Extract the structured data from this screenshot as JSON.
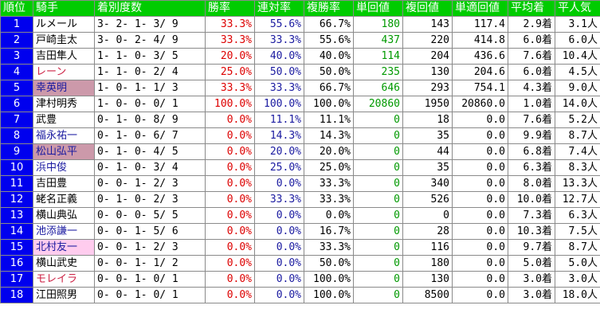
{
  "headers": [
    "順位",
    "騎手",
    "着別度数",
    "勝率",
    "連対率",
    "複勝率",
    "単回値",
    "複回値",
    "単適回値",
    "平均着",
    "平人気"
  ],
  "rows": [
    {
      "rank": "1",
      "jockey": "ルメール",
      "jockey_color": "black",
      "jockey_bg": "",
      "dist": "3- 2- 1- 3/ 9",
      "win": "33.3%",
      "top2": "55.6%",
      "top3": "66.7%",
      "win_ret": "180",
      "place_ret": "143",
      "adj_ret": "117.4",
      "avg_finish": "2.9着",
      "avg_pop": "3.1人"
    },
    {
      "rank": "2",
      "jockey": "戸崎圭太",
      "jockey_color": "black",
      "jockey_bg": "",
      "dist": "3- 0- 2- 4/ 9",
      "win": "33.3%",
      "top2": "33.3%",
      "top3": "55.6%",
      "win_ret": "437",
      "place_ret": "220",
      "adj_ret": "414.8",
      "avg_finish": "6.0着",
      "avg_pop": "6.0人"
    },
    {
      "rank": "3",
      "jockey": "吉田隼人",
      "jockey_color": "black",
      "jockey_bg": "",
      "dist": "1- 1- 0- 3/ 5",
      "win": "20.0%",
      "top2": "40.0%",
      "top3": "40.0%",
      "win_ret": "114",
      "place_ret": "204",
      "adj_ret": "436.6",
      "avg_finish": "7.6着",
      "avg_pop": "10.4人"
    },
    {
      "rank": "4",
      "jockey": "レーン",
      "jockey_color": "red",
      "jockey_bg": "",
      "dist": "1- 1- 0- 2/ 4",
      "win": "25.0%",
      "top2": "50.0%",
      "top3": "50.0%",
      "win_ret": "235",
      "place_ret": "130",
      "adj_ret": "204.6",
      "avg_finish": "6.0着",
      "avg_pop": "4.5人"
    },
    {
      "rank": "5",
      "jockey": "幸英明",
      "jockey_color": "blue",
      "jockey_bg": "rose",
      "dist": "1- 0- 1- 1/ 3",
      "win": "33.3%",
      "top2": "33.3%",
      "top3": "66.7%",
      "win_ret": "646",
      "place_ret": "293",
      "adj_ret": "754.1",
      "avg_finish": "4.3着",
      "avg_pop": "9.0人"
    },
    {
      "rank": "6",
      "jockey": "津村明秀",
      "jockey_color": "black",
      "jockey_bg": "",
      "dist": "1- 0- 0- 0/ 1",
      "win": "100.0%",
      "top2": "100.0%",
      "top3": "100.0%",
      "win_ret": "20860",
      "place_ret": "1950",
      "adj_ret": "20860.0",
      "avg_finish": "1.0着",
      "avg_pop": "14.0人"
    },
    {
      "rank": "7",
      "jockey": "武豊",
      "jockey_color": "black",
      "jockey_bg": "",
      "dist": "0- 1- 0- 8/ 9",
      "win": "0.0%",
      "top2": "11.1%",
      "top3": "11.1%",
      "win_ret": "0",
      "place_ret": "18",
      "adj_ret": "0.0",
      "avg_finish": "7.6着",
      "avg_pop": "5.2人"
    },
    {
      "rank": "8",
      "jockey": "福永祐一",
      "jockey_color": "blue",
      "jockey_bg": "",
      "dist": "0- 1- 0- 6/ 7",
      "win": "0.0%",
      "top2": "14.3%",
      "top3": "14.3%",
      "win_ret": "0",
      "place_ret": "35",
      "adj_ret": "0.0",
      "avg_finish": "9.9着",
      "avg_pop": "8.7人"
    },
    {
      "rank": "9",
      "jockey": "松山弘平",
      "jockey_color": "blue",
      "jockey_bg": "rose",
      "dist": "0- 1- 0- 4/ 5",
      "win": "0.0%",
      "top2": "20.0%",
      "top3": "20.0%",
      "win_ret": "0",
      "place_ret": "44",
      "adj_ret": "0.0",
      "avg_finish": "6.8着",
      "avg_pop": "7.4人"
    },
    {
      "rank": "10",
      "jockey": "浜中俊",
      "jockey_color": "blue",
      "jockey_bg": "",
      "dist": "0- 1- 0- 3/ 4",
      "win": "0.0%",
      "top2": "25.0%",
      "top3": "25.0%",
      "win_ret": "0",
      "place_ret": "35",
      "adj_ret": "0.0",
      "avg_finish": "6.3着",
      "avg_pop": "8.3人"
    },
    {
      "rank": "11",
      "jockey": "吉田豊",
      "jockey_color": "black",
      "jockey_bg": "",
      "dist": "0- 0- 1- 2/ 3",
      "win": "0.0%",
      "top2": "0.0%",
      "top3": "33.3%",
      "win_ret": "0",
      "place_ret": "340",
      "adj_ret": "0.0",
      "avg_finish": "8.0着",
      "avg_pop": "13.3人"
    },
    {
      "rank": "12",
      "jockey": "蛯名正義",
      "jockey_color": "black",
      "jockey_bg": "",
      "dist": "0- 1- 0- 2/ 3",
      "win": "0.0%",
      "top2": "33.3%",
      "top3": "33.3%",
      "win_ret": "0",
      "place_ret": "526",
      "adj_ret": "0.0",
      "avg_finish": "10.0着",
      "avg_pop": "12.7人"
    },
    {
      "rank": "13",
      "jockey": "横山典弘",
      "jockey_color": "black",
      "jockey_bg": "",
      "dist": "0- 0- 0- 5/ 5",
      "win": "0.0%",
      "top2": "0.0%",
      "top3": "0.0%",
      "win_ret": "0",
      "place_ret": "0",
      "adj_ret": "0.0",
      "avg_finish": "7.3着",
      "avg_pop": "6.3人"
    },
    {
      "rank": "14",
      "jockey": "池添謙一",
      "jockey_color": "blue",
      "jockey_bg": "",
      "dist": "0- 0- 1- 5/ 6",
      "win": "0.0%",
      "top2": "0.0%",
      "top3": "16.7%",
      "win_ret": "0",
      "place_ret": "28",
      "adj_ret": "0.0",
      "avg_finish": "10.3着",
      "avg_pop": "7.5人"
    },
    {
      "rank": "15",
      "jockey": "北村友一",
      "jockey_color": "blue",
      "jockey_bg": "pink",
      "dist": "0- 0- 1- 2/ 3",
      "win": "0.0%",
      "top2": "0.0%",
      "top3": "33.3%",
      "win_ret": "0",
      "place_ret": "116",
      "adj_ret": "0.0",
      "avg_finish": "9.7着",
      "avg_pop": "8.7人"
    },
    {
      "rank": "16",
      "jockey": "横山武史",
      "jockey_color": "black",
      "jockey_bg": "",
      "dist": "0- 0- 1- 1/ 2",
      "win": "0.0%",
      "top2": "0.0%",
      "top3": "50.0%",
      "win_ret": "0",
      "place_ret": "180",
      "adj_ret": "0.0",
      "avg_finish": "5.0着",
      "avg_pop": "5.0人"
    },
    {
      "rank": "17",
      "jockey": "モレイラ",
      "jockey_color": "red",
      "jockey_bg": "",
      "dist": "0- 0- 1- 0/ 1",
      "win": "0.0%",
      "top2": "0.0%",
      "top3": "100.0%",
      "win_ret": "0",
      "place_ret": "130",
      "adj_ret": "0.0",
      "avg_finish": "3.0着",
      "avg_pop": "3.0人"
    },
    {
      "rank": "18",
      "jockey": "江田照男",
      "jockey_color": "black",
      "jockey_bg": "",
      "dist": "0- 0- 1- 0/ 1",
      "win": "0.0%",
      "top2": "0.0%",
      "top3": "100.0%",
      "win_ret": "0",
      "place_ret": "8500",
      "adj_ret": "0.0",
      "avg_finish": "3.0着",
      "avg_pop": "18.0人"
    }
  ],
  "colors": {
    "header_bg": "#00cc00",
    "rank_bg": "#0000ee",
    "win_rate": "#dd0000",
    "top2_rate": "#1a1aa0",
    "win_return": "#009900",
    "jockey_blue": "#1a1aa0",
    "jockey_red": "#cc2244",
    "highlight_pink": "#ffccee",
    "highlight_rose": "#cc99aa"
  }
}
